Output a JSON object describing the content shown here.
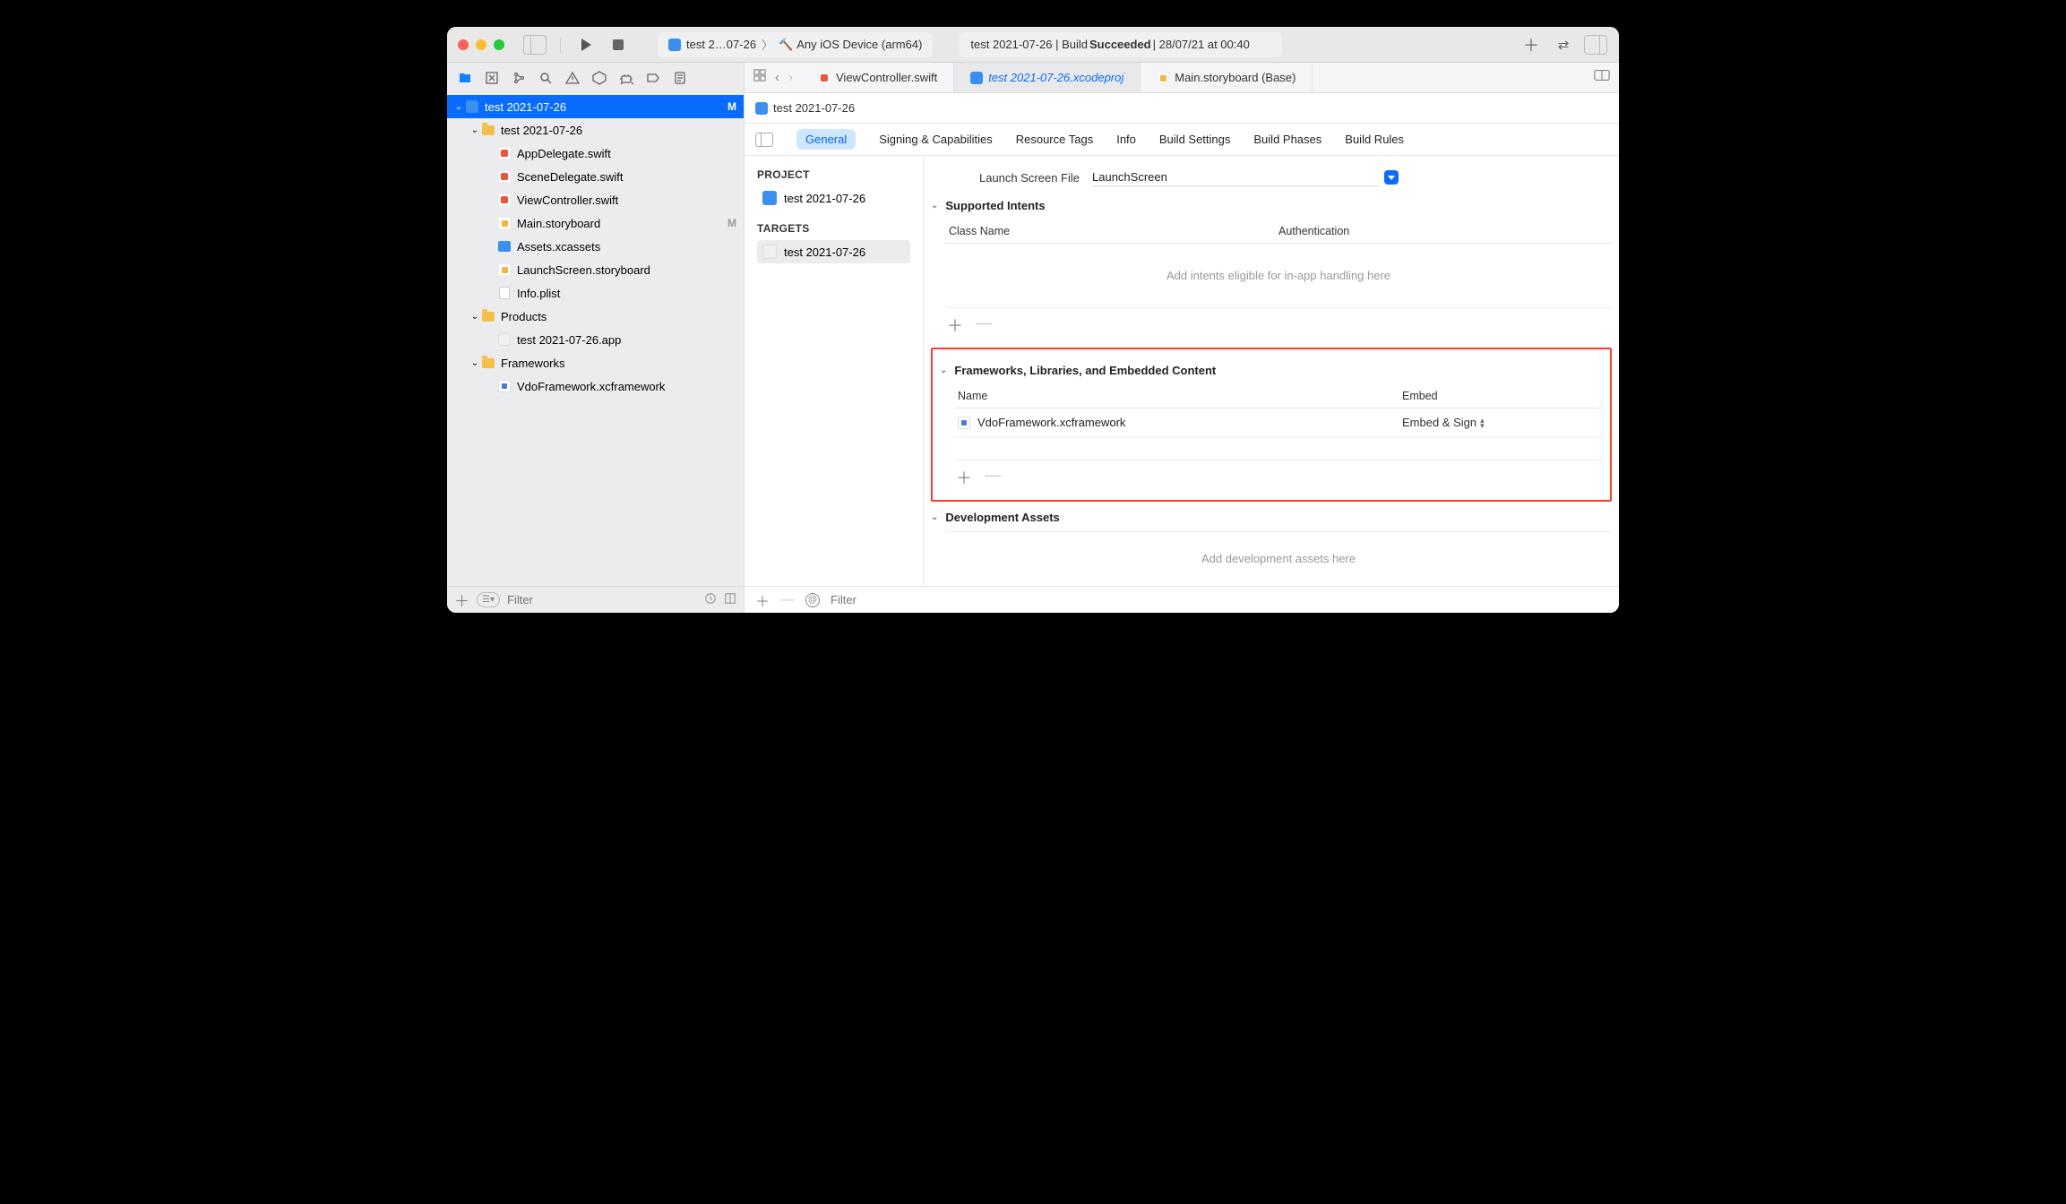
{
  "titlebar": {
    "breadcrumb_app": "test 2…07-26",
    "breadcrumb_target": "Any iOS Device (arm64)",
    "status_prefix": "test 2021-07-26 | Build ",
    "status_result": "Succeeded",
    "status_suffix": " | 28/07/21 at 00:40"
  },
  "editor_tabs": [
    {
      "label": "ViewController.swift",
      "active": false,
      "icon": "swift"
    },
    {
      "label": "test 2021-07-26.xcodeproj",
      "active": true,
      "icon": "proj"
    },
    {
      "label": "Main.storyboard (Base)",
      "active": false,
      "icon": "sb"
    }
  ],
  "nav": {
    "root": {
      "label": "test 2021-07-26",
      "badge": "M"
    },
    "items": [
      {
        "indent": 1,
        "icon": "folder",
        "label": "test 2021-07-26",
        "disclosure": "open"
      },
      {
        "indent": 2,
        "icon": "swift",
        "label": "AppDelegate.swift"
      },
      {
        "indent": 2,
        "icon": "swift",
        "label": "SceneDelegate.swift"
      },
      {
        "indent": 2,
        "icon": "swift",
        "label": "ViewController.swift"
      },
      {
        "indent": 2,
        "icon": "sb",
        "label": "Main.storyboard",
        "badge": "M"
      },
      {
        "indent": 2,
        "icon": "asset",
        "label": "Assets.xcassets"
      },
      {
        "indent": 2,
        "icon": "sb",
        "label": "LaunchScreen.storyboard"
      },
      {
        "indent": 2,
        "icon": "plist",
        "label": "Info.plist"
      },
      {
        "indent": 1,
        "icon": "folder",
        "label": "Products",
        "disclosure": "open"
      },
      {
        "indent": 2,
        "icon": "app",
        "label": "test 2021-07-26.app"
      },
      {
        "indent": 1,
        "icon": "folder",
        "label": "Frameworks",
        "disclosure": "open"
      },
      {
        "indent": 2,
        "icon": "xcfw",
        "label": "VdoFramework.xcframework"
      }
    ],
    "filter_placeholder": "Filter"
  },
  "crumb": {
    "label": "test 2021-07-26"
  },
  "settings_tabs": [
    "General",
    "Signing & Capabilities",
    "Resource Tags",
    "Info",
    "Build Settings",
    "Build Phases",
    "Build Rules"
  ],
  "settings_active": "General",
  "targets": {
    "project_header": "PROJECT",
    "project_name": "test 2021-07-26",
    "targets_header": "TARGETS",
    "target_name": "test 2021-07-26"
  },
  "general": {
    "launch_label": "Launch Screen File",
    "launch_value": "LaunchScreen",
    "intents_header": "Supported Intents",
    "intents_cols": [
      "Class Name",
      "Authentication"
    ],
    "intents_empty": "Add intents eligible for in-app handling here",
    "frameworks_header": "Frameworks, Libraries, and Embedded Content",
    "fw_cols": [
      "Name",
      "Embed"
    ],
    "fw_row_name": "VdoFramework.xcframework",
    "fw_row_embed": "Embed & Sign",
    "dev_assets_header": "Development Assets",
    "dev_assets_empty": "Add development assets here"
  },
  "editor_filter_placeholder": "Filter"
}
